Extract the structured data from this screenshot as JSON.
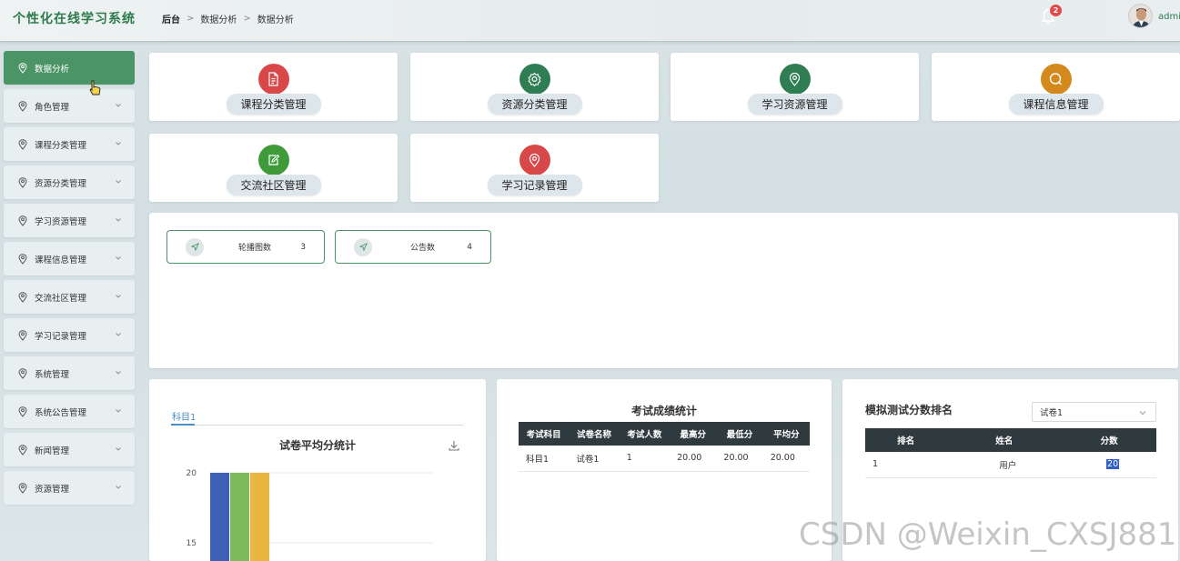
{
  "header": {
    "app_title": "个性化在线学习系统",
    "breadcrumb": [
      "后台",
      "数据分析",
      "数据分析"
    ],
    "notification_count": "2",
    "username": "admi"
  },
  "sidebar": {
    "items": [
      {
        "label": "数据分析",
        "active": true
      },
      {
        "label": "角色管理"
      },
      {
        "label": "课程分类管理"
      },
      {
        "label": "资源分类管理"
      },
      {
        "label": "学习资源管理"
      },
      {
        "label": "课程信息管理"
      },
      {
        "label": "交流社区管理"
      },
      {
        "label": "学习记录管理"
      },
      {
        "label": "系统管理"
      },
      {
        "label": "系统公告管理"
      },
      {
        "label": "新闻管理"
      },
      {
        "label": "资源管理"
      }
    ]
  },
  "tiles": [
    {
      "label": "课程分类管理",
      "icon": "document-icon",
      "color": "#d94848"
    },
    {
      "label": "资源分类管理",
      "icon": "gear-icon",
      "color": "#2f7d52"
    },
    {
      "label": "学习资源管理",
      "icon": "location-icon",
      "color": "#2f7d52"
    },
    {
      "label": "课程信息管理",
      "icon": "search-icon",
      "color": "#d4891c"
    },
    {
      "label": "交流社区管理",
      "icon": "edit-icon",
      "color": "#3f9a3a"
    },
    {
      "label": "学习记录管理",
      "icon": "location-icon",
      "color": "#d94848"
    }
  ],
  "stats": [
    {
      "label": "轮播图数",
      "value": "3"
    },
    {
      "label": "公告数",
      "value": "4"
    }
  ],
  "avg_chart": {
    "tab": "科目1",
    "title": "试卷平均分统计"
  },
  "chart_data": {
    "type": "bar",
    "title": "试卷平均分统计",
    "y_ticks": [
      "20",
      "15"
    ],
    "ylim": [
      15,
      20
    ],
    "series": [
      {
        "values": [
          20
        ],
        "color": "#3e5fb6"
      },
      {
        "values": [
          20
        ],
        "color": "#7dba5d"
      },
      {
        "values": [
          20
        ],
        "color": "#e9b740"
      }
    ]
  },
  "exam_stats": {
    "title": "考试成绩统计",
    "columns": [
      "考试科目",
      "试卷名称",
      "考试人数",
      "最高分",
      "最低分",
      "平均分"
    ],
    "rows": [
      [
        "科目1",
        "试卷1",
        "1",
        "20.00",
        "20.00",
        "20.00"
      ]
    ]
  },
  "ranking": {
    "title": "模拟测试分数排名",
    "select_value": "试卷1",
    "columns": [
      "排名",
      "姓名",
      "分数"
    ],
    "rows": [
      [
        "1",
        "用户",
        "20"
      ]
    ]
  },
  "watermark": "CSDN @Weixin_CXSJ881"
}
